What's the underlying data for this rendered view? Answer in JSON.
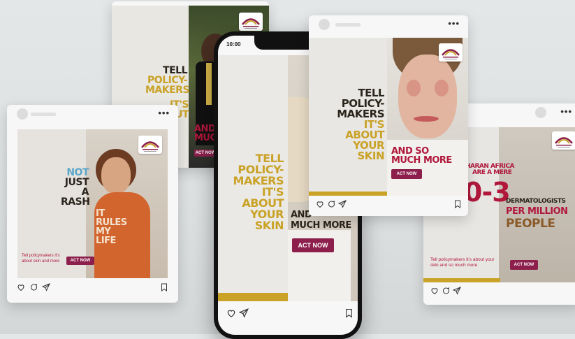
{
  "headline_lines": [
    "TELL",
    "POLICY-",
    "MAKERS",
    "IT'S ABOUT",
    "YOUR SKIN"
  ],
  "and_so": "AND SO",
  "much_more": "MUCH MORE",
  "and_so_cut": "AND",
  "much_cut": "MUCH",
  "cta": "ACT NOW",
  "rash_post": {
    "not": "NOT",
    "just": "JUST",
    "a": "A",
    "rash": "RASH",
    "it": "IT",
    "rules": "RULES",
    "my": "MY",
    "life": "LIFE",
    "caption": "Tell policymakers it's about skin and more"
  },
  "stat_post": {
    "region": "HARAN AFRICA",
    "are_a_mere": "ARE A MERE",
    "number": "0-3",
    "dermatologists": "DERMATOLOGISTS",
    "per_million": "PER MILLION",
    "people": "PEOPLE",
    "caption": "Tell policymakers it's about your skin and so much more"
  },
  "phone": {
    "time": "10:00"
  },
  "icons": [
    "heart-icon",
    "comment-icon",
    "send-icon",
    "bookmark-icon",
    "more-dots-icon"
  ],
  "colors": {
    "gold": "#c9a227",
    "crimson": "#b0173b",
    "magenta": "#8c1f4c",
    "dark": "#2a241c",
    "blue": "#5aa6c9"
  }
}
